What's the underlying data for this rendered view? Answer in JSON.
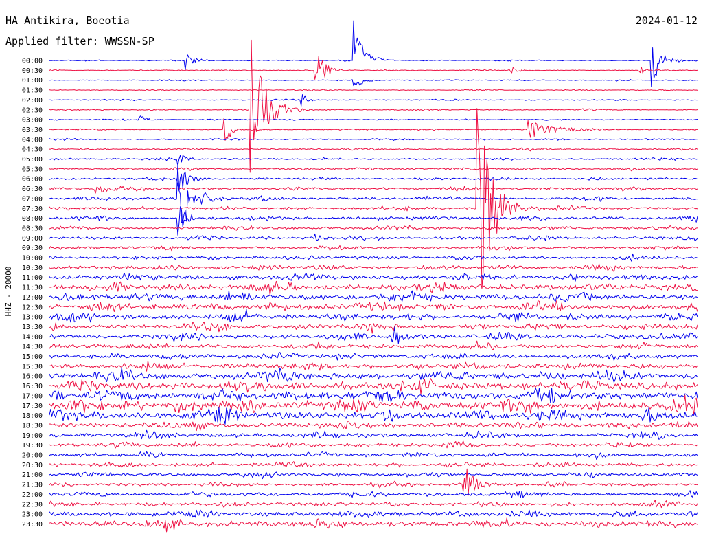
{
  "header": {
    "station": "HA Antikira, Boeotia",
    "date": "2024-01-12",
    "filter_label": "Applied filter: WWSSN-SP"
  },
  "axis": {
    "channel_label": "HHZ - 20000"
  },
  "colors": {
    "even_trace": "#0000ee",
    "odd_trace": "#ee1144",
    "text": "#000000",
    "background": "#ffffff"
  },
  "chart_data": {
    "type": "line",
    "title": "HA Antikira, Boeotia",
    "subtitle": "Applied filter: WWSSN-SP",
    "ylabel": "HHZ - 20000",
    "rows": [
      "00:00",
      "00:30",
      "01:00",
      "01:30",
      "02:00",
      "02:30",
      "03:00",
      "03:30",
      "04:00",
      "04:30",
      "05:00",
      "05:30",
      "06:00",
      "06:30",
      "07:00",
      "07:30",
      "08:00",
      "08:30",
      "09:00",
      "09:30",
      "10:00",
      "10:30",
      "11:00",
      "11:30",
      "12:00",
      "12:30",
      "13:00",
      "13:30",
      "14:00",
      "14:30",
      "15:00",
      "15:30",
      "16:00",
      "16:30",
      "17:00",
      "17:30",
      "18:00",
      "18:30",
      "19:00",
      "19:30",
      "20:00",
      "20:30",
      "21:00",
      "21:30",
      "22:00",
      "22:30",
      "23:00",
      "23:30"
    ],
    "row_colors": [
      "blue",
      "red"
    ],
    "noise_level": [
      0.3,
      0.3,
      0.3,
      0.3,
      0.35,
      0.35,
      0.35,
      0.35,
      0.4,
      0.45,
      0.55,
      0.6,
      0.7,
      0.8,
      0.9,
      0.9,
      1.0,
      0.95,
      1.0,
      0.95,
      1.0,
      1.3,
      1.6,
      2.0,
      2.0,
      2.0,
      1.9,
      1.7,
      1.6,
      1.5,
      1.5,
      1.8,
      2.4,
      2.6,
      2.8,
      3.0,
      2.8,
      1.8,
      1.4,
      1.3,
      1.2,
      1.2,
      1.1,
      1.0,
      1.2,
      1.2,
      1.6,
      2.0
    ],
    "events": [
      {
        "row": 0,
        "t": 0.21,
        "amp": 14,
        "decay": 0.012,
        "dir": "both"
      },
      {
        "row": 0,
        "t": 0.47,
        "amp": 90,
        "decay": 0.015,
        "dir": "up"
      },
      {
        "row": 0,
        "t": 0.93,
        "amp": 40,
        "decay": 0.012,
        "dir": "both"
      },
      {
        "row": 1,
        "t": 0.41,
        "amp": 40,
        "decay": 0.012,
        "dir": "both"
      },
      {
        "row": 1,
        "t": 0.71,
        "amp": 8,
        "decay": 0.01,
        "dir": "both"
      },
      {
        "row": 1,
        "t": 0.91,
        "amp": 8,
        "decay": 0.01,
        "dir": "both"
      },
      {
        "row": 2,
        "t": 0.47,
        "amp": 22,
        "decay": 0.01,
        "dir": "down"
      },
      {
        "row": 4,
        "t": 0.39,
        "amp": 10,
        "decay": 0.008,
        "dir": "both"
      },
      {
        "row": 5,
        "t": 0.31,
        "amp": 110,
        "decay": 0.02,
        "dir": "both"
      },
      {
        "row": 6,
        "t": 0.14,
        "amp": 10,
        "decay": 0.008,
        "dir": "both"
      },
      {
        "row": 7,
        "t": 0.27,
        "amp": 30,
        "decay": 0.01,
        "dir": "both"
      },
      {
        "row": 7,
        "t": 0.74,
        "amp": 14,
        "decay": 0.04,
        "dir": "both"
      },
      {
        "row": 10,
        "t": 0.2,
        "amp": 10,
        "decay": 0.01,
        "dir": "both"
      },
      {
        "row": 12,
        "t": 0.2,
        "amp": 24,
        "decay": 0.015,
        "dir": "both"
      },
      {
        "row": 13,
        "t": 0.07,
        "amp": 10,
        "decay": 0.02,
        "dir": "both"
      },
      {
        "row": 14,
        "t": 0.2,
        "amp": 60,
        "decay": 0.02,
        "dir": "both"
      },
      {
        "row": 15,
        "t": 0.66,
        "amp": 170,
        "decay": 0.02,
        "dir": "both"
      },
      {
        "row": 16,
        "t": 0.2,
        "amp": 24,
        "decay": 0.01,
        "dir": "both"
      },
      {
        "row": 18,
        "t": 0.41,
        "amp": 10,
        "decay": 0.01,
        "dir": "both"
      },
      {
        "row": 28,
        "t": 0.53,
        "amp": 20,
        "decay": 0.012,
        "dir": "both"
      },
      {
        "row": 43,
        "t": 0.64,
        "amp": 35,
        "decay": 0.015,
        "dir": "both"
      }
    ]
  }
}
